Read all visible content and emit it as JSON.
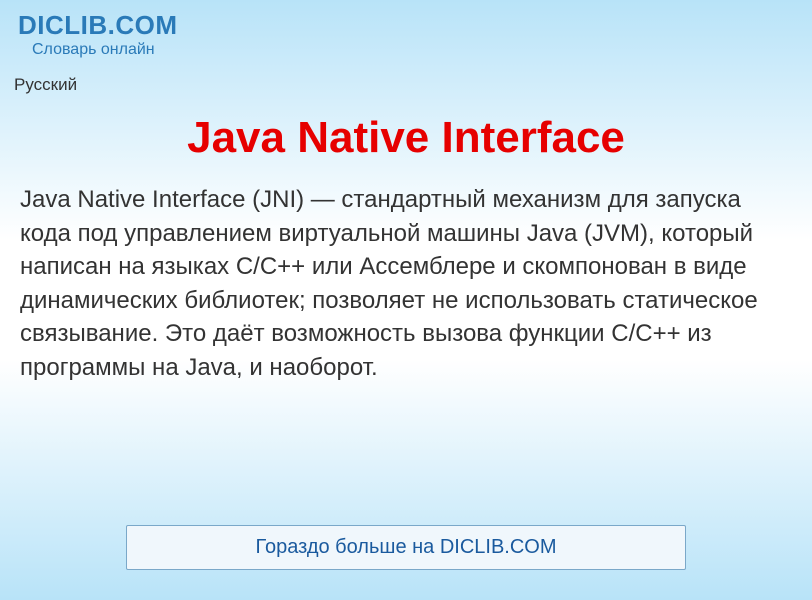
{
  "header": {
    "logo": "DICLIB.COM",
    "subtitle": "Словарь онлайн"
  },
  "language": "Русский",
  "article": {
    "title": "Java Native Interface",
    "text": "Java Native Interface (JNI) — стандартный механизм для запуска кода под управлением виртуальной машины Java (JVM), который написан на языках С/C++ или Ассемблере и скомпонован в виде динамических библиотек; позволяет не использовать статическое связывание. Это даёт возможность вызова функции С/C++ из программы на Java, и наоборот."
  },
  "footer": {
    "link_text": "Гораздо больше на DICLIB.COM"
  }
}
